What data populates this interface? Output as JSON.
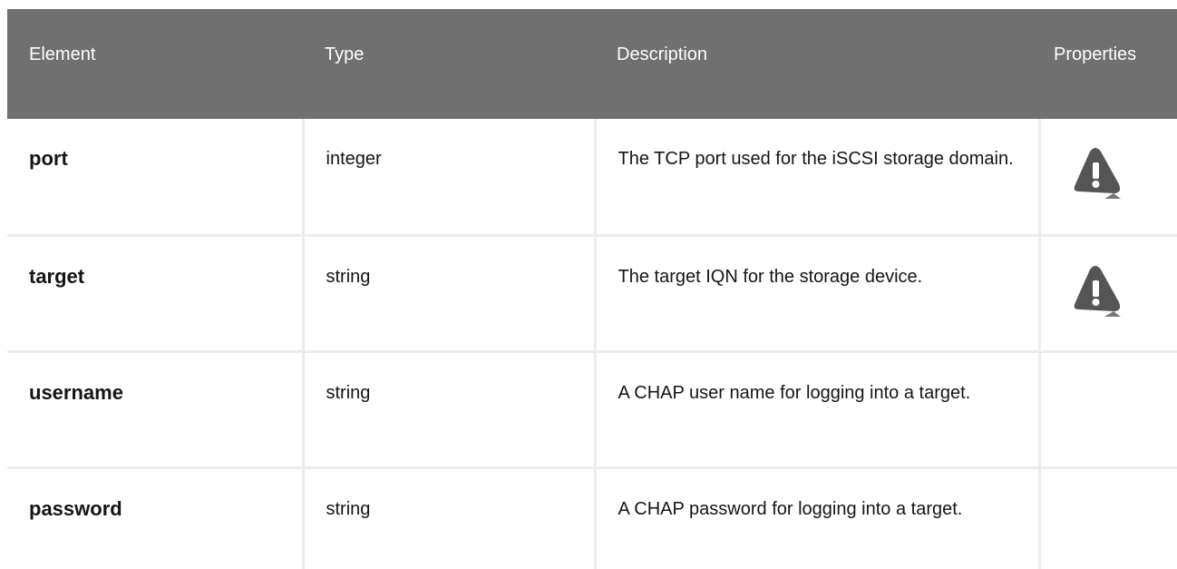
{
  "table": {
    "headers": [
      "Element",
      "Type",
      "Description",
      "Properties"
    ],
    "rows": [
      {
        "element": "port",
        "type": "integer",
        "description": "The TCP port used for the iSCSI storage domain.",
        "properties_icon": "warning-icon"
      },
      {
        "element": "target",
        "type": "string",
        "description": "The target IQN for the storage device.",
        "properties_icon": "warning-icon"
      },
      {
        "element": "username",
        "type": "string",
        "description": "A CHAP user name for logging into a target.",
        "properties_icon": ""
      },
      {
        "element": "password",
        "type": "string",
        "description": "A CHAP password for logging into a target.",
        "properties_icon": ""
      }
    ]
  },
  "colors": {
    "header_bg": "#707070",
    "header_text": "#ffffff",
    "divider": "#ececec",
    "icon_fill": "#555555"
  }
}
